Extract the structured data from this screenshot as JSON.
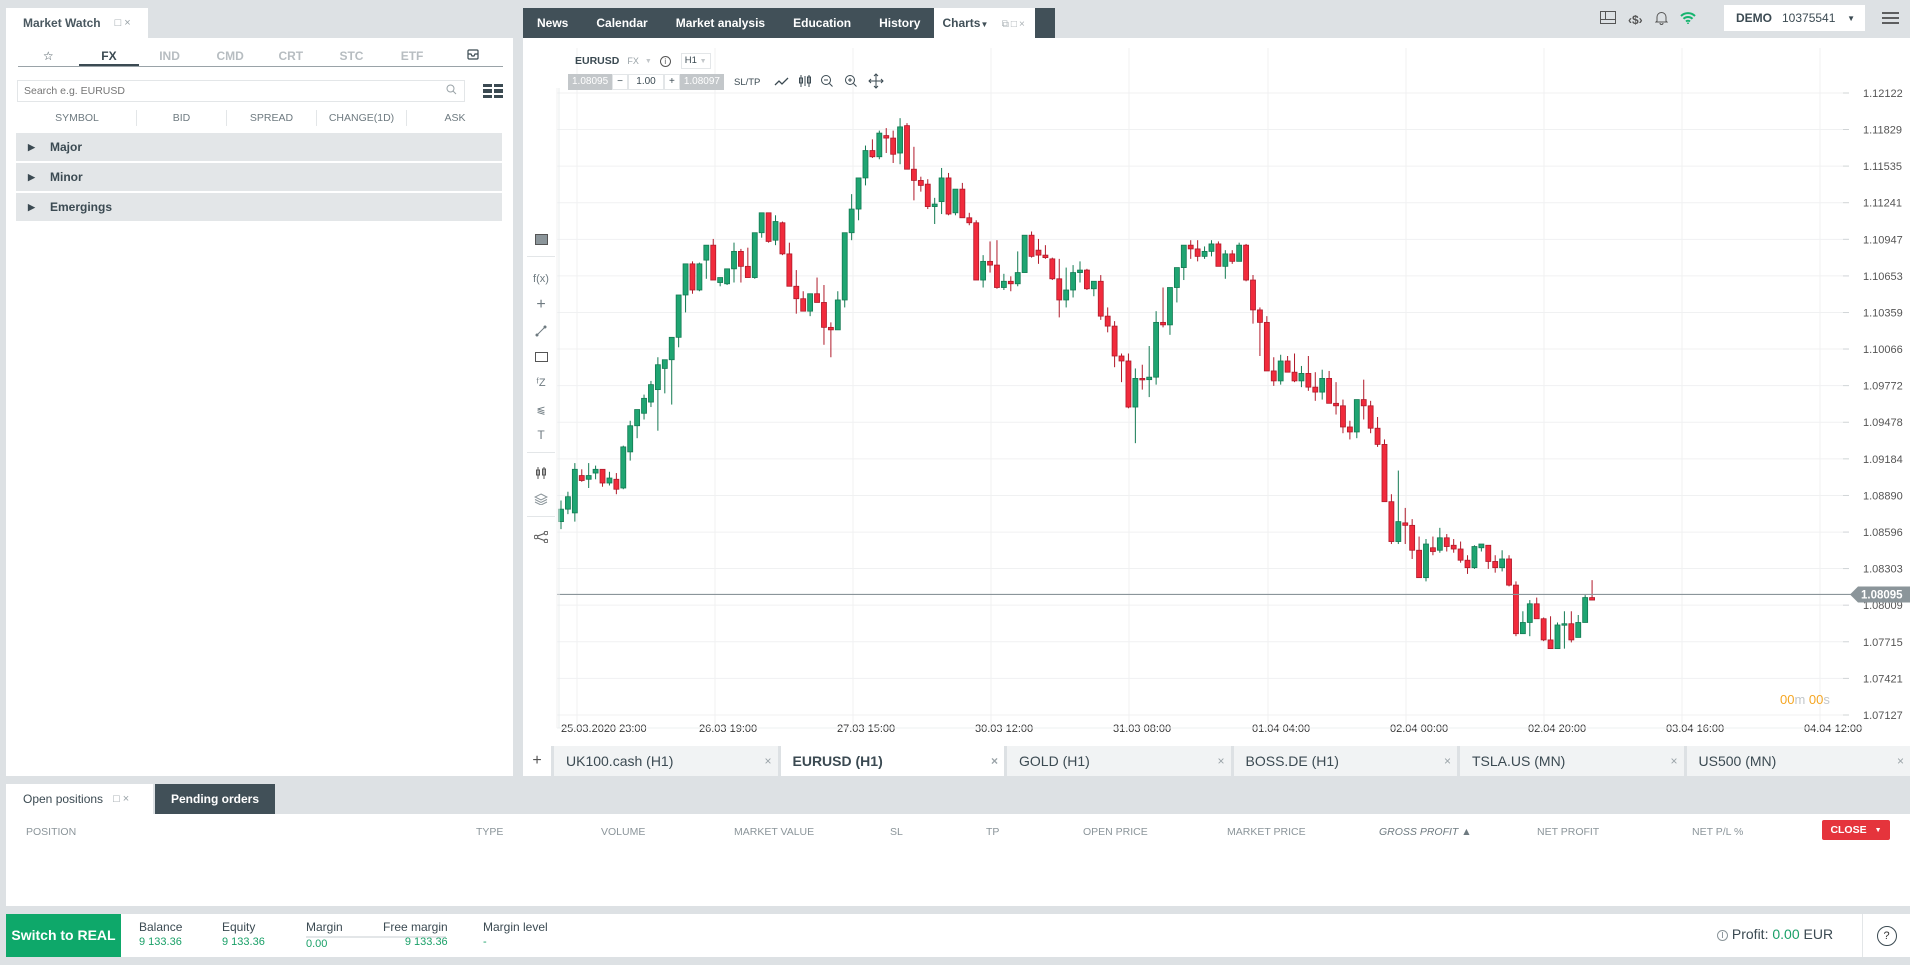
{
  "market_watch": {
    "title": "Market Watch",
    "categories": [
      "☆",
      "FX",
      "IND",
      "CMD",
      "CRT",
      "STC",
      "ETF"
    ],
    "active_category": "FX",
    "search_placeholder": "Search e.g. EURUSD",
    "columns": [
      "SYMBOL",
      "BID",
      "SPREAD",
      "CHANGE(1D)",
      "ASK"
    ],
    "groups": [
      "Major",
      "Minor",
      "Emergings"
    ]
  },
  "top_nav": {
    "items": [
      "News",
      "Calendar",
      "Market analysis",
      "Education",
      "History"
    ],
    "active": "Charts"
  },
  "account": {
    "mode": "DEMO",
    "number": "10375541"
  },
  "chart": {
    "symbol": "EURUSD",
    "class": "FX",
    "timeframe": "H1",
    "bid": "1.08095",
    "ask": "1.08097",
    "volume": "1.00",
    "sltp": "SL/TP",
    "timer_min": "00",
    "timer_sec": "00",
    "current_price_label": "1.08095"
  },
  "chart_data": {
    "type": "candlestick",
    "title": "EURUSD (H1)",
    "y_ticks": [
      "1.12122",
      "1.11829",
      "1.11535",
      "1.11241",
      "1.10947",
      "1.10653",
      "1.10359",
      "1.10066",
      "1.09772",
      "1.09478",
      "1.09184",
      "1.08890",
      "1.08596",
      "1.08303",
      "1.08009",
      "1.07715",
      "1.07421",
      "1.07127"
    ],
    "x_ticks": [
      "25.03.2020 23:00",
      "26.03 19:00",
      "27.03 15:00",
      "30.03 12:00",
      "31.03 08:00",
      "01.04 04:00",
      "02.04 00:00",
      "02.04 20:00",
      "03.04 16:00",
      "04.04 12:00"
    ],
    "ylim": [
      1.071,
      1.1235
    ],
    "current_price": 1.08095,
    "up_color": "#1fa572",
    "down_color": "#f12b3c",
    "candles": [
      [
        1.0868,
        1.0885,
        1.0862,
        1.0878
      ],
      [
        1.0878,
        1.0892,
        1.0874,
        1.0888
      ],
      [
        1.0875,
        1.0915,
        1.0868,
        1.091
      ],
      [
        1.0905,
        1.091,
        1.09,
        1.0901
      ],
      [
        1.0902,
        1.0915,
        1.0895,
        1.0905
      ],
      [
        1.0907,
        1.0913,
        1.0902,
        1.091
      ],
      [
        1.091,
        1.091,
        1.0896,
        1.0899
      ],
      [
        1.0899,
        1.0908,
        1.0897,
        1.0903
      ],
      [
        1.0902,
        1.0907,
        1.089,
        1.0894
      ],
      [
        1.0895,
        1.0929,
        1.0894,
        1.0928
      ],
      [
        1.0924,
        1.0949,
        1.0917,
        1.0945
      ],
      [
        1.0945,
        1.0958,
        1.0935,
        1.0958
      ],
      [
        1.0955,
        1.097,
        1.095,
        1.0967
      ],
      [
        1.0964,
        1.0981,
        1.096,
        1.0978
      ],
      [
        1.0974,
        1.1,
        1.0941,
        1.0994
      ],
      [
        1.0991,
        1.0995,
        1.0971,
        1.0998
      ],
      [
        1.0998,
        1.1007,
        1.0962,
        1.1016
      ],
      [
        1.1016,
        1.1038,
        1.1008,
        1.105
      ],
      [
        1.105,
        1.107,
        1.1036,
        1.1075
      ],
      [
        1.1075,
        1.1077,
        1.1051,
        1.1054
      ],
      [
        1.1054,
        1.1076,
        1.1053,
        1.1075
      ],
      [
        1.1078,
        1.108,
        1.1063,
        1.109
      ],
      [
        1.109,
        1.1095,
        1.1063,
        1.1062
      ],
      [
        1.106,
        1.1064,
        1.1057,
        1.1064
      ],
      [
        1.1059,
        1.1071,
        1.1058,
        1.1071
      ],
      [
        1.1071,
        1.1092,
        1.106,
        1.1085
      ],
      [
        1.1085,
        1.1087,
        1.106,
        1.1073
      ],
      [
        1.1073,
        1.1088,
        1.1072,
        1.1064
      ],
      [
        1.1064,
        1.1068,
        1.1063,
        1.11
      ],
      [
        1.11,
        1.1116,
        1.1096,
        1.1116
      ],
      [
        1.1116,
        1.1116,
        1.1092,
        1.1093
      ],
      [
        1.1094,
        1.1114,
        1.109,
        1.1109
      ],
      [
        1.1108,
        1.1109,
        1.1082,
        1.1083
      ],
      [
        1.1083,
        1.1092,
        1.1068,
        1.1057
      ],
      [
        1.1057,
        1.107,
        1.1035,
        1.1047
      ],
      [
        1.1047,
        1.1053,
        1.104,
        1.1037
      ],
      [
        1.1037,
        1.1049,
        1.1033,
        1.1051
      ],
      [
        1.1051,
        1.1064,
        1.105,
        1.1044
      ],
      [
        1.1044,
        1.1058,
        1.101,
        1.1024
      ],
      [
        1.1024,
        1.1028,
        1.1,
        1.1022
      ],
      [
        1.1022,
        1.1053,
        1.1022,
        1.1046
      ],
      [
        1.1046,
        1.1098,
        1.104,
        1.11
      ],
      [
        1.11,
        1.1131,
        1.1094,
        1.1119
      ],
      [
        1.1119,
        1.1143,
        1.111,
        1.1144
      ],
      [
        1.1144,
        1.117,
        1.1138,
        1.1166
      ],
      [
        1.1166,
        1.1175,
        1.116,
        1.1161
      ],
      [
        1.1161,
        1.1182,
        1.1159,
        1.118
      ],
      [
        1.1178,
        1.1184,
        1.1164,
        1.1176
      ],
      [
        1.1176,
        1.1182,
        1.1156,
        1.1163
      ],
      [
        1.1164,
        1.1192,
        1.1155,
        1.1185
      ],
      [
        1.1186,
        1.1188,
        1.1162,
        1.1151
      ],
      [
        1.1151,
        1.1169,
        1.1126,
        1.1142
      ],
      [
        1.1142,
        1.1145,
        1.1133,
        1.1138
      ],
      [
        1.1139,
        1.1143,
        1.1119,
        1.1121
      ],
      [
        1.1121,
        1.1128,
        1.1107,
        1.1123
      ],
      [
        1.1125,
        1.1152,
        1.1115,
        1.1144
      ],
      [
        1.1144,
        1.1148,
        1.1114,
        1.1115
      ],
      [
        1.1116,
        1.1135,
        1.1114,
        1.1135
      ],
      [
        1.1135,
        1.114,
        1.1112,
        1.1112
      ],
      [
        1.1112,
        1.1116,
        1.1106,
        1.1108
      ],
      [
        1.1108,
        1.111,
        1.1063,
        1.1062
      ],
      [
        1.1062,
        1.1082,
        1.1056,
        1.1077
      ],
      [
        1.1077,
        1.1093,
        1.1068,
        1.1074
      ],
      [
        1.1074,
        1.1094,
        1.1055,
        1.1056
      ],
      [
        1.1056,
        1.1067,
        1.1054,
        1.1061
      ],
      [
        1.1061,
        1.1065,
        1.1053,
        1.1059
      ],
      [
        1.1059,
        1.1085,
        1.1057,
        1.1068
      ],
      [
        1.1068,
        1.1098,
        1.1069,
        1.1098
      ],
      [
        1.1098,
        1.1101,
        1.108,
        1.1081
      ],
      [
        1.1086,
        1.1095,
        1.1075,
        1.1082
      ],
      [
        1.1082,
        1.109,
        1.1079,
        1.108
      ],
      [
        1.1079,
        1.108,
        1.1062,
        1.1063
      ],
      [
        1.1063,
        1.1079,
        1.1032,
        1.1046
      ],
      [
        1.1046,
        1.1072,
        1.104,
        1.1054
      ],
      [
        1.1054,
        1.1074,
        1.1048,
        1.1068
      ],
      [
        1.1068,
        1.1077,
        1.106,
        1.107
      ],
      [
        1.107,
        1.1071,
        1.1054,
        1.1055
      ],
      [
        1.1055,
        1.1061,
        1.1049,
        1.1061
      ],
      [
        1.1061,
        1.1066,
        1.103,
        1.1033
      ],
      [
        1.1033,
        1.104,
        1.102,
        1.1025
      ],
      [
        1.1025,
        1.1029,
        1.0992,
        1.1001
      ],
      [
        1.1001,
        1.1003,
        1.098,
        1.0997
      ],
      [
        1.0997,
        1.1003,
        1.0959,
        1.096
      ],
      [
        1.096,
        1.0991,
        1.0931,
        1.0983
      ],
      [
        1.0983,
        1.0994,
        1.0974,
        1.0982
      ],
      [
        1.0982,
        1.1009,
        1.0968,
        1.0984
      ],
      [
        1.0984,
        1.1037,
        1.0978,
        1.1028
      ],
      [
        1.1028,
        1.1056,
        1.1024,
        1.1026
      ],
      [
        1.1026,
        1.1038,
        1.1018,
        1.1056
      ],
      [
        1.1056,
        1.1061,
        1.1044,
        1.1072
      ],
      [
        1.1072,
        1.1082,
        1.1062,
        1.109
      ],
      [
        1.109,
        1.1094,
        1.1079,
        1.1087
      ],
      [
        1.1087,
        1.1094,
        1.1077,
        1.1081
      ],
      [
        1.1081,
        1.1089,
        1.1079,
        1.1085
      ],
      [
        1.1085,
        1.1094,
        1.1081,
        1.1091
      ],
      [
        1.1091,
        1.1093,
        1.1079,
        1.1073
      ],
      [
        1.1073,
        1.1086,
        1.1063,
        1.1083
      ],
      [
        1.1083,
        1.1086,
        1.1075,
        1.1077
      ],
      [
        1.1077,
        1.1092,
        1.1078,
        1.109
      ],
      [
        1.109,
        1.1091,
        1.1061,
        1.1062
      ],
      [
        1.1062,
        1.1066,
        1.1027,
        1.1038
      ],
      [
        1.1038,
        1.104,
        1.1001,
        1.1028
      ],
      [
        1.1028,
        1.1033,
        1.099,
        1.0989
      ],
      [
        1.0989,
        1.1,
        1.0977,
        1.0981
      ],
      [
        1.0981,
        1.1002,
        1.0978,
        1.0997
      ],
      [
        1.0997,
        1.1001,
        1.0989,
        1.0988
      ],
      [
        1.0988,
        1.1003,
        1.098,
        1.0981
      ],
      [
        1.0981,
        1.0993,
        1.0976,
        1.0987
      ],
      [
        1.0987,
        1.1001,
        1.0973,
        1.0976
      ],
      [
        1.0976,
        1.0988,
        1.0965,
        1.0972
      ],
      [
        1.0972,
        1.099,
        1.0966,
        1.0983
      ],
      [
        1.0983,
        1.0989,
        1.0968,
        1.0963
      ],
      [
        1.0963,
        1.098,
        1.0954,
        1.0961
      ],
      [
        1.0961,
        1.0966,
        1.0939,
        1.0944
      ],
      [
        1.0944,
        1.0949,
        1.0934,
        1.094
      ],
      [
        1.094,
        1.0966,
        1.0935,
        1.0966
      ],
      [
        1.0966,
        1.0982,
        1.095,
        1.0961
      ],
      [
        1.0961,
        1.0965,
        1.0939,
        1.0943
      ],
      [
        1.0943,
        1.0952,
        1.0928,
        1.093
      ],
      [
        1.093,
        1.0934,
        1.0884,
        1.0884
      ],
      [
        1.0884,
        1.089,
        1.085,
        1.0852
      ],
      [
        1.0852,
        1.0909,
        1.085,
        1.0868
      ],
      [
        1.0867,
        1.0879,
        1.085,
        1.0865
      ],
      [
        1.0865,
        1.087,
        1.0838,
        1.0845
      ],
      [
        1.0845,
        1.0856,
        1.0827,
        1.0823
      ],
      [
        1.0823,
        1.0854,
        1.082,
        1.085
      ],
      [
        1.0847,
        1.0856,
        1.0841,
        1.0844
      ],
      [
        1.0845,
        1.0863,
        1.0843,
        1.0855
      ],
      [
        1.0855,
        1.0858,
        1.0844,
        1.0848
      ],
      [
        1.0849,
        1.0854,
        1.0843,
        1.0846
      ],
      [
        1.0846,
        1.0852,
        1.0835,
        1.0837
      ],
      [
        1.0837,
        1.0841,
        1.0826,
        1.0831
      ],
      [
        1.0831,
        1.0849,
        1.083,
        1.0848
      ],
      [
        1.0847,
        1.0849,
        1.0844,
        1.085
      ],
      [
        1.0849,
        1.0849,
        1.083,
        1.0836
      ],
      [
        1.0836,
        1.0841,
        1.0827,
        1.0831
      ],
      [
        1.0831,
        1.0845,
        1.0828,
        1.0838
      ],
      [
        1.0838,
        1.0841,
        1.0816,
        1.0817
      ],
      [
        1.0817,
        1.082,
        1.0776,
        1.0778
      ],
      [
        1.0778,
        1.0796,
        1.0778,
        1.0787
      ],
      [
        1.0787,
        1.0805,
        1.0776,
        1.0802
      ],
      [
        1.0802,
        1.0807,
        1.079,
        1.079
      ],
      [
        1.079,
        1.0791,
        1.0772,
        1.0773
      ],
      [
        1.0773,
        1.0792,
        1.0769,
        1.0766
      ],
      [
        1.0766,
        1.0787,
        1.0767,
        1.0785
      ],
      [
        1.0785,
        1.0796,
        1.0766,
        1.0786
      ],
      [
        1.0786,
        1.0796,
        1.0771,
        1.0773
      ],
      [
        1.0775,
        1.0793,
        1.0779,
        1.0787
      ],
      [
        1.0787,
        1.0809,
        1.0787,
        1.0807
      ],
      [
        1.0807,
        1.0821,
        1.0806,
        1.0805
      ]
    ]
  },
  "chart_tabs": {
    "add_label": "+",
    "tabs": [
      "UK100.cash (H1)",
      "EURUSD (H1)",
      "GOLD (H1)",
      "BOSS.DE (H1)",
      "TSLA.US (MN)",
      "US500 (MN)"
    ],
    "active": "EURUSD (H1)"
  },
  "positions": {
    "tab_open": "Open positions",
    "tab_pending": "Pending orders",
    "columns": [
      "POSITION",
      "TYPE",
      "VOLUME",
      "MARKET VALUE",
      "SL",
      "TP",
      "OPEN PRICE",
      "MARKET PRICE",
      "GROSS PROFIT ▲",
      "NET PROFIT",
      "NET P/L %"
    ],
    "close_label": "CLOSE"
  },
  "account_bar": {
    "switch_label": "Switch to REAL",
    "balance_label": "Balance",
    "balance": "9 133.36",
    "equity_label": "Equity",
    "equity": "9 133.36",
    "margin_label": "Margin",
    "margin": "0.00",
    "free_margin_label": "Free margin",
    "free_margin": "9 133.36",
    "margin_level_label": "Margin level",
    "margin_level": "-",
    "profit_label": "Profit:",
    "profit": "0.00",
    "currency": "EUR"
  }
}
